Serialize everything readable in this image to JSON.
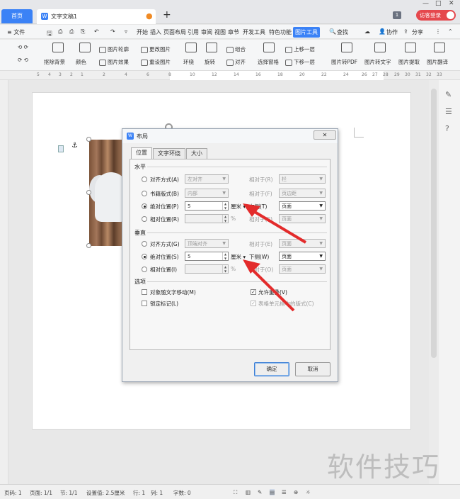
{
  "titlebar": {
    "home_tab": "首页",
    "doc_tab": "文字文稿1",
    "doc_tab_icon": "W",
    "new_tab": "+",
    "badge": "1",
    "login": "访客登录"
  },
  "menubar": {
    "file": "≡ 文件",
    "items": [
      "开始",
      "插入",
      "页面布局",
      "引用",
      "审阅",
      "视图",
      "章节",
      "开发工具",
      "特色功能"
    ],
    "active": "图片工具",
    "search": "查找",
    "collab": "协作",
    "share": "分享"
  },
  "ribbon": {
    "items": [
      "抠除背景",
      "颜色",
      "图片轮廓",
      "图片效果",
      "更改图片",
      "重设图片",
      "环绕",
      "旋转",
      "组合",
      "对齐",
      "选择窗格",
      "上移一层",
      "下移一层",
      "图片转PDF",
      "图片转文字",
      "图片提取",
      "图片翻译"
    ]
  },
  "ruler": {
    "marks": [
      "5",
      "4",
      "3",
      "2",
      "1",
      "2",
      "4",
      "6",
      "8",
      "10",
      "12",
      "14",
      "16",
      "18",
      "20",
      "22",
      "24",
      "26",
      "27",
      "28",
      "29",
      "30",
      "31",
      "32",
      "33"
    ]
  },
  "dialog": {
    "title": "布局",
    "title_icon": "W",
    "tabs": [
      "位置",
      "文字环绕",
      "大小"
    ],
    "horizontal": {
      "section": "水平",
      "align_label": "对齐方式(A)",
      "align_value": "左对齐",
      "align_rel_label": "相对于(R)",
      "align_rel_value": "栏",
      "book_label": "书籍版式(B)",
      "book_value": "内部",
      "book_rel_label": "相对于(F)",
      "book_rel_value": "页边距",
      "abs_label": "绝对位置(P)",
      "abs_value": "5",
      "abs_unit": "厘米",
      "abs_rel_label": "右侧(T)",
      "abs_rel_value": "页面",
      "rel_label": "相对位置(R)",
      "rel_unit": "%",
      "rel_rel_label": "相对于(E)",
      "rel_rel_value": "页面"
    },
    "vertical": {
      "section": "垂直",
      "align_label": "对齐方式(G)",
      "align_value": "顶端对齐",
      "align_rel_label": "相对于(E)",
      "align_rel_value": "页面",
      "abs_label": "绝对位置(S)",
      "abs_value": "5",
      "abs_unit": "厘米",
      "abs_rel_label": "下侧(W)",
      "abs_rel_value": "页面",
      "rel_label": "相对位置(I)",
      "rel_unit": "%",
      "rel_rel_label": "相对于(O)",
      "rel_rel_value": "页面"
    },
    "options": {
      "section": "选项",
      "move_with_text": "对象随文字移动(M)",
      "lock_anchor": "锁定标记(L)",
      "allow_overlap": "允许重叠(V)",
      "allow_overlap_checked": true,
      "table_layout": "表格单元格中的版式(C)"
    },
    "ok": "确定",
    "cancel": "取消"
  },
  "status": {
    "page": "页码: 1",
    "pages": "页面: 1/1",
    "section": "节: 1/1",
    "setting": "设置值: 2.5厘米",
    "row": "行: 1",
    "col": "列: 1",
    "words": "字数: 0"
  },
  "watermark": "软件技巧",
  "colors": {
    "accent": "#3b82f6",
    "login": "#e5484d",
    "arrow": "#e32b2b"
  }
}
